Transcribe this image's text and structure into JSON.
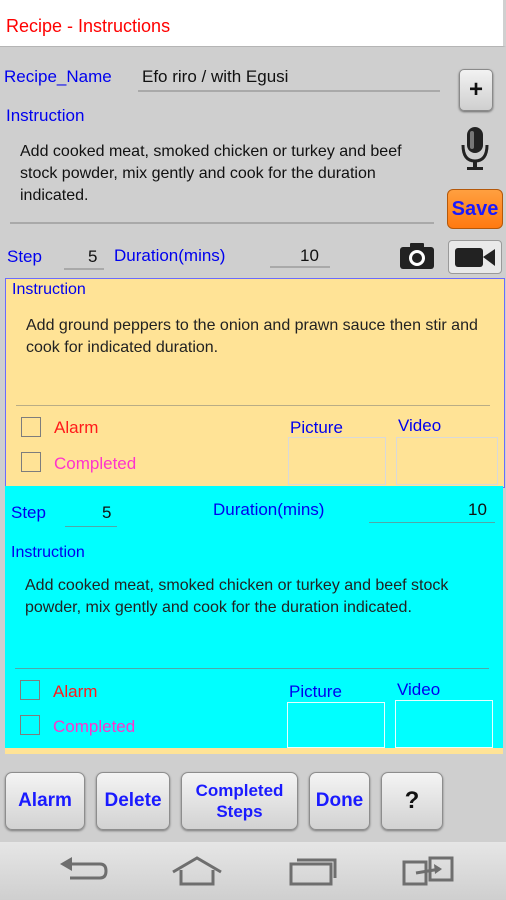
{
  "title": "Recipe - Instructions",
  "recipe": {
    "name_label": "Recipe_Name",
    "name_value": "Efo riro / with Egusi",
    "instruction_label": "Instruction",
    "instruction_value": "Add cooked meat, smoked chicken or turkey and beef stock powder, mix gently and cook for the duration indicated.",
    "add_button": "+",
    "save_button": "Save",
    "step_label": "Step",
    "step_value": "5",
    "duration_label": "Duration(mins)",
    "duration_value": "10"
  },
  "steps": [
    {
      "instruction_label": "Instruction",
      "instruction_text": "Add ground peppers to the onion and prawn sauce then stir and cook for indicated duration.",
      "alarm_label": "Alarm",
      "completed_label": "Completed",
      "picture_label": "Picture",
      "video_label": "Video",
      "color": "#ffe396"
    },
    {
      "step_label": "Step",
      "step_value": "5",
      "duration_label": "Duration(mins)",
      "duration_value": "10",
      "instruction_label": "Instruction",
      "instruction_text": "Add cooked meat, smoked chicken or turkey and beef stock powder, mix gently and cook for the duration indicated.",
      "alarm_label": "Alarm",
      "completed_label": "Completed",
      "picture_label": "Picture",
      "video_label": "Video",
      "color": "#00ffff"
    }
  ],
  "buttons": {
    "alarm": "Alarm",
    "delete": "Delete",
    "completed_steps": "Completed Steps",
    "done": "Done",
    "help": "?"
  },
  "icons": {
    "mic": "microphone-icon",
    "camera": "camera-icon",
    "video": "video-camera-icon",
    "nav_back": "back-icon",
    "nav_home": "home-icon",
    "nav_recents": "recents-icon",
    "nav_switch": "switch-icon"
  }
}
